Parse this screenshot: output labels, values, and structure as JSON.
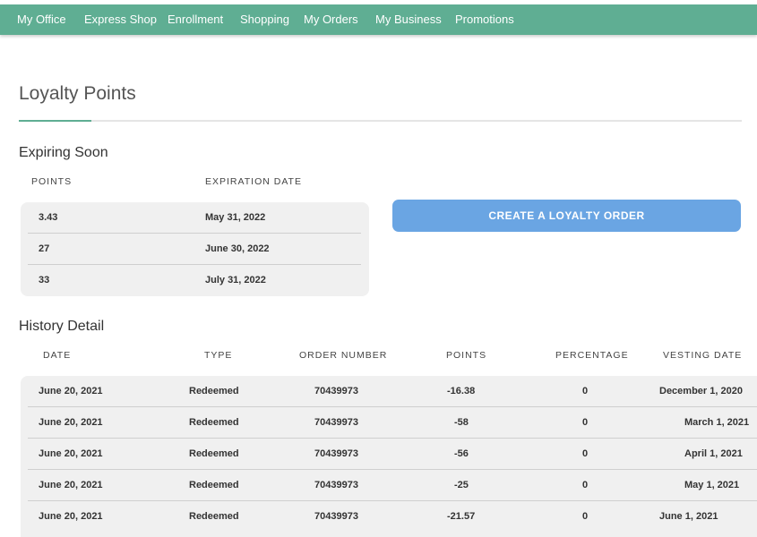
{
  "nav": {
    "items": [
      "My Office",
      "Express Shop",
      "Enrollment",
      "Shopping",
      "My Orders",
      "My Business",
      "Promotions"
    ]
  },
  "page": {
    "title": "Loyalty Points"
  },
  "expiring": {
    "title": "Expiring Soon",
    "headers": [
      "POINTS",
      "EXPIRATION DATE"
    ],
    "rows": [
      [
        "3.43",
        "May 31, 2022"
      ],
      [
        "27",
        "June 30, 2022"
      ],
      [
        "33",
        "July 31, 2022"
      ]
    ]
  },
  "actions": {
    "create_loyalty_order": "CREATE A LOYALTY ORDER"
  },
  "history": {
    "title": "History Detail",
    "headers": [
      "DATE",
      "TYPE",
      "ORDER NUMBER",
      "POINTS",
      "PERCENTAGE",
      "VESTING DATE"
    ],
    "rows": [
      [
        "June 20, 2021",
        "Redeemed",
        "70439973",
        "-16.38",
        "0",
        "December 1, 2020"
      ],
      [
        "June 20, 2021",
        "Redeemed",
        "70439973",
        "-58",
        "0",
        "March 1, 2021"
      ],
      [
        "June 20, 2021",
        "Redeemed",
        "70439973",
        "-56",
        "0",
        "April 1, 2021"
      ],
      [
        "June 20, 2021",
        "Redeemed",
        "70439973",
        "-25",
        "0",
        "May 1, 2021"
      ],
      [
        "June 20, 2021",
        "Redeemed",
        "70439973",
        "-21.57",
        "0",
        "June 1, 2021"
      ]
    ]
  }
}
